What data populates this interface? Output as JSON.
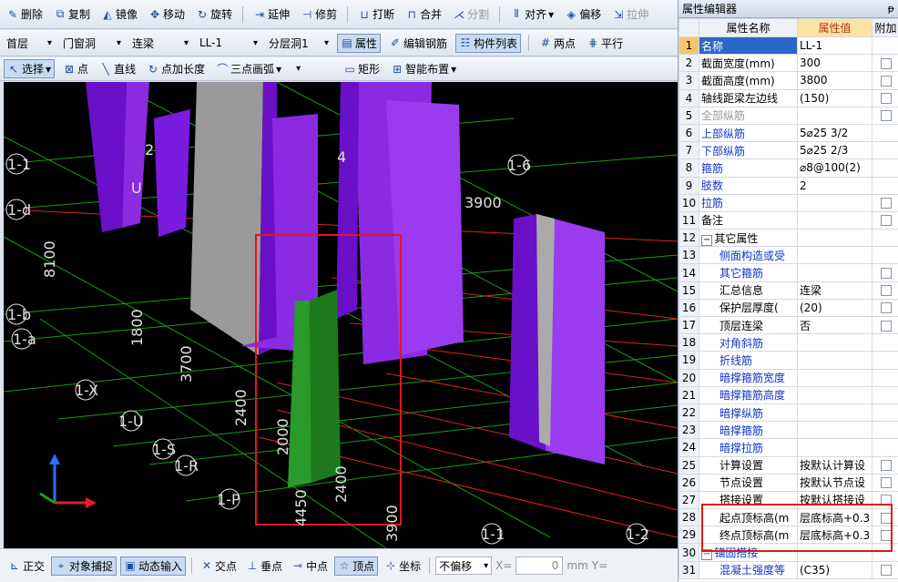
{
  "toolbar1": {
    "delete": "删除",
    "copy": "复制",
    "mirror": "镜像",
    "move": "移动",
    "rotate": "旋转",
    "extend": "延伸",
    "trim": "修剪",
    "break": "打断",
    "merge": "合并",
    "split": "分割",
    "align": "对齐",
    "offset": "偏移",
    "stretch": "拉伸"
  },
  "toolbar2": {
    "floor": "首层",
    "category": "门窗洞",
    "type": "连梁",
    "element": "LL-1",
    "layer": "分层洞1",
    "properties": "属性",
    "edit_rebar": "编辑钢筋",
    "component_list": "构件列表",
    "two_points": "两点",
    "parallel": "平行"
  },
  "toolbar3": {
    "select": "选择",
    "point": "点",
    "line": "直线",
    "point_length": "点加长度",
    "arc": "三点画弧",
    "rect": "矩形",
    "smart_layout": "智能布置"
  },
  "canvas": {
    "labels": [
      "1-1",
      "1-d",
      "1-b",
      "1-a",
      "1-X",
      "1-U",
      "1-S",
      "1-R",
      "1-P",
      "1-6",
      "1-1",
      "1-2",
      "2",
      "4",
      "U"
    ],
    "dims": [
      "3900",
      "8100",
      "1800",
      "3700",
      "2400",
      "2000",
      "2400",
      "4450",
      "3900"
    ]
  },
  "statusbar": {
    "ortho": "正交",
    "snap": "对象捕捉",
    "dyn_input": "动态输入",
    "intersect": "交点",
    "perp": "垂点",
    "mid": "中点",
    "vertex": "顶点",
    "coord": "坐标",
    "offset_mode": "不偏移",
    "x_label": "X=",
    "x_value": "0",
    "unit": "mm",
    "y_label": "Y="
  },
  "panel": {
    "title": "属性编辑器",
    "col_name": "属性名称",
    "col_value": "属性值",
    "col_extra": "附加",
    "rows": [
      {
        "n": "1",
        "name": "名称",
        "value": "LL-1"
      },
      {
        "n": "2",
        "name": "截面宽度(mm)",
        "value": "300"
      },
      {
        "n": "3",
        "name": "截面高度(mm)",
        "value": "3800"
      },
      {
        "n": "4",
        "name": "轴线距梁左边线",
        "value": "(150)"
      },
      {
        "n": "5",
        "name": "全部纵筋",
        "value": ""
      },
      {
        "n": "6",
        "name": "上部纵筋",
        "value": "5⌀25 3/2"
      },
      {
        "n": "7",
        "name": "下部纵筋",
        "value": "5⌀25 2/3"
      },
      {
        "n": "8",
        "name": "箍筋",
        "value": "⌀8@100(2)"
      },
      {
        "n": "9",
        "name": "肢数",
        "value": "2"
      },
      {
        "n": "10",
        "name": "拉筋",
        "value": ""
      },
      {
        "n": "11",
        "name": "备注",
        "value": ""
      },
      {
        "n": "12",
        "name": "其它属性",
        "value": ""
      },
      {
        "n": "13",
        "name": "侧面构造或受",
        "value": ""
      },
      {
        "n": "14",
        "name": "其它箍筋",
        "value": ""
      },
      {
        "n": "15",
        "name": "汇总信息",
        "value": "连梁"
      },
      {
        "n": "16",
        "name": "保护层厚度(",
        "value": "(20)"
      },
      {
        "n": "17",
        "name": "顶层连梁",
        "value": "否"
      },
      {
        "n": "18",
        "name": "对角斜筋",
        "value": ""
      },
      {
        "n": "19",
        "name": "折线筋",
        "value": ""
      },
      {
        "n": "20",
        "name": "暗撑箍筋宽度",
        "value": ""
      },
      {
        "n": "21",
        "name": "暗撑箍筋高度",
        "value": ""
      },
      {
        "n": "22",
        "name": "暗撑纵筋",
        "value": ""
      },
      {
        "n": "23",
        "name": "暗撑箍筋",
        "value": ""
      },
      {
        "n": "24",
        "name": "暗撑拉筋",
        "value": ""
      },
      {
        "n": "25",
        "name": "计算设置",
        "value": "按默认计算设"
      },
      {
        "n": "26",
        "name": "节点设置",
        "value": "按默认节点设"
      },
      {
        "n": "27",
        "name": "搭接设置",
        "value": "按默认搭接设"
      },
      {
        "n": "28",
        "name": "起点顶标高(m",
        "value": "层底标高+0.3"
      },
      {
        "n": "29",
        "name": "终点顶标高(m",
        "value": "层底标高+0.3"
      },
      {
        "n": "30",
        "name": "锚固搭接",
        "value": ""
      },
      {
        "n": "31",
        "name": "混凝土强度等",
        "value": "(C35)"
      }
    ]
  }
}
